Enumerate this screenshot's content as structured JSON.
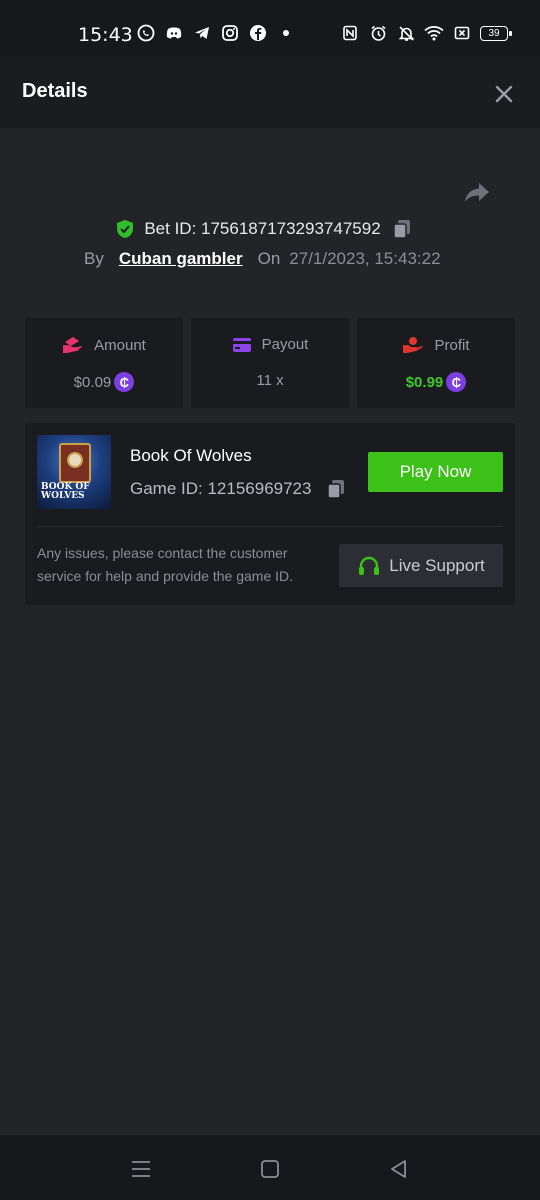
{
  "status_bar": {
    "time": "15:43",
    "battery": "39",
    "left_icons": [
      "whatsapp-icon",
      "discord-icon",
      "telegram-icon",
      "instagram-icon",
      "facebook-icon",
      "dot-icon"
    ],
    "right_icons": [
      "nfc-icon",
      "alarm-icon",
      "mute-icon",
      "wifi-icon",
      "sim-icon",
      "battery-icon"
    ]
  },
  "header": {
    "title": "Details"
  },
  "bet": {
    "id_text": "Bet ID: 1756187173293747592",
    "by_label": "By",
    "user": "Cuban gambler",
    "on_label": "On",
    "date": "27/1/2023, 15:43:22"
  },
  "stats": {
    "amount_label": "Amount",
    "amount_value": "$0.09",
    "payout_label": "Payout",
    "payout_value": "11 x",
    "profit_label": "Profit",
    "profit_value": "$0.99",
    "coin_symbol": "₵"
  },
  "game": {
    "name": "Book Of Wolves",
    "id_text": "Game ID: 12156969723",
    "thumb_text_line1": "BOOK OF",
    "thumb_text_line2": "WOLVES",
    "play_label": "Play Now",
    "support_text": "Any issues, please contact the customer service for help and provide the game ID.",
    "live_support_label": "Live Support"
  },
  "colors": {
    "accent_green": "#3bc117",
    "coin_purple": "#7b3fe4",
    "shield_green": "#2fbf2a",
    "amount_pink": "#e8336d",
    "payout_purple": "#8a44e8",
    "profit_red": "#e0362f"
  }
}
